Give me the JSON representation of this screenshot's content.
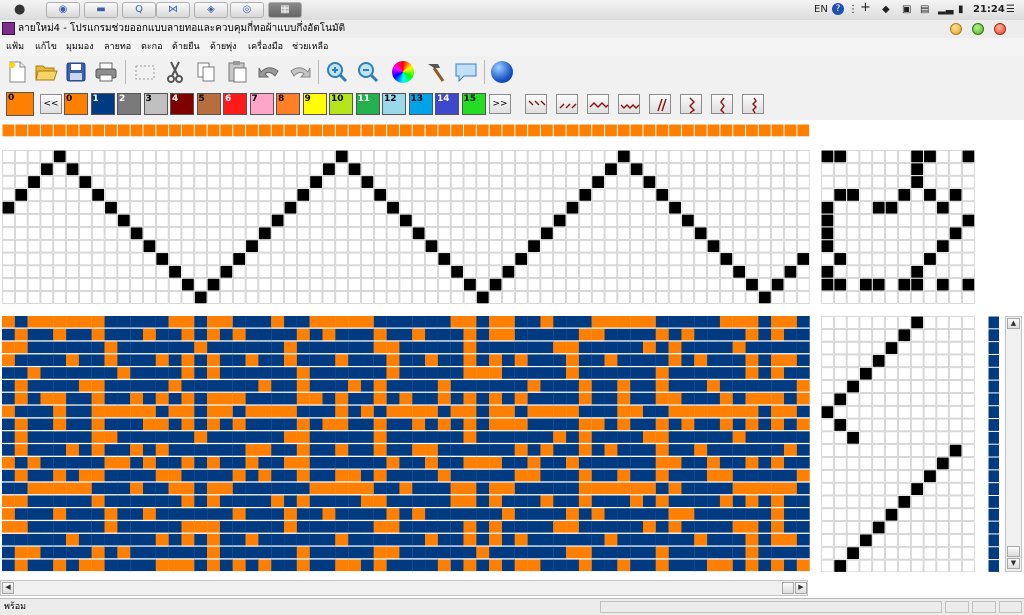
{
  "system": {
    "input_lang": "EN",
    "clock": "21:24",
    "taskbar_icons": [
      "apple-logo-icon",
      "browser-icon",
      "folder-icon",
      "search-icon",
      "visual-studio-icon",
      "app-icon-1",
      "app-icon-2",
      "pattern-app-icon"
    ]
  },
  "window": {
    "title": "ลายใหม่4 - โปรแกรมช่วยออกแบบลายทอและควบคุมกี่ทอผ้าแบบกึ่งอัตโนมัติ"
  },
  "menu": [
    "แฟ้ม",
    "แก้ไข",
    "มุมมอง",
    "ลายทอ",
    "ตะกอ",
    "ด้ายยืน",
    "ด้ายพุ่ง",
    "เครื่องมือ",
    "ช่วยเหลือ"
  ],
  "toolbar": {
    "buttons": [
      "new-file-icon",
      "open-folder-icon",
      "save-icon",
      "print-icon",
      "select-icon",
      "cut-icon",
      "copy-icon",
      "paste-icon",
      "undo-icon",
      "redo-icon",
      "zoom-in-icon",
      "zoom-out-icon",
      "color-wheel-icon",
      "hammer-icon",
      "comment-icon",
      "globe-icon"
    ]
  },
  "palette": {
    "current_label": "0",
    "current_color": "#ff7f00",
    "prev_label": "<<",
    "next_label": ">>",
    "swatches": [
      {
        "label": "0",
        "color": "#ff7f00"
      },
      {
        "label": "1",
        "color": "#003a80"
      },
      {
        "label": "2",
        "color": "#7a7a7a"
      },
      {
        "label": "3",
        "color": "#c0c0c0"
      },
      {
        "label": "4",
        "color": "#800000"
      },
      {
        "label": "5",
        "color": "#b86e3c"
      },
      {
        "label": "6",
        "color": "#ff1a1a"
      },
      {
        "label": "7",
        "color": "#ffa6c8"
      },
      {
        "label": "8",
        "color": "#ff7f27"
      },
      {
        "label": "9",
        "color": "#ffff00"
      },
      {
        "label": "10",
        "color": "#b5e61d"
      },
      {
        "label": "11",
        "color": "#22b14c"
      },
      {
        "label": "12",
        "color": "#99d9ea"
      },
      {
        "label": "13",
        "color": "#00a2e8"
      },
      {
        "label": "14",
        "color": "#3f48cc"
      },
      {
        "label": "15",
        "color": "#22dd22"
      }
    ],
    "patterns": [
      "twill-backslash-pattern",
      "twill-slash-pattern",
      "wave-pattern",
      "zigzag-pattern",
      "diagonal-steep-pattern",
      "step-pattern",
      "zigzag-vertical-pattern",
      "wave-vertical-pattern"
    ]
  },
  "colors": {
    "orange": "#ff7f00",
    "blue": "#003a80",
    "grid": "#bfbfbf",
    "black": "#000000"
  },
  "status": {
    "text": "พร้อม"
  }
}
